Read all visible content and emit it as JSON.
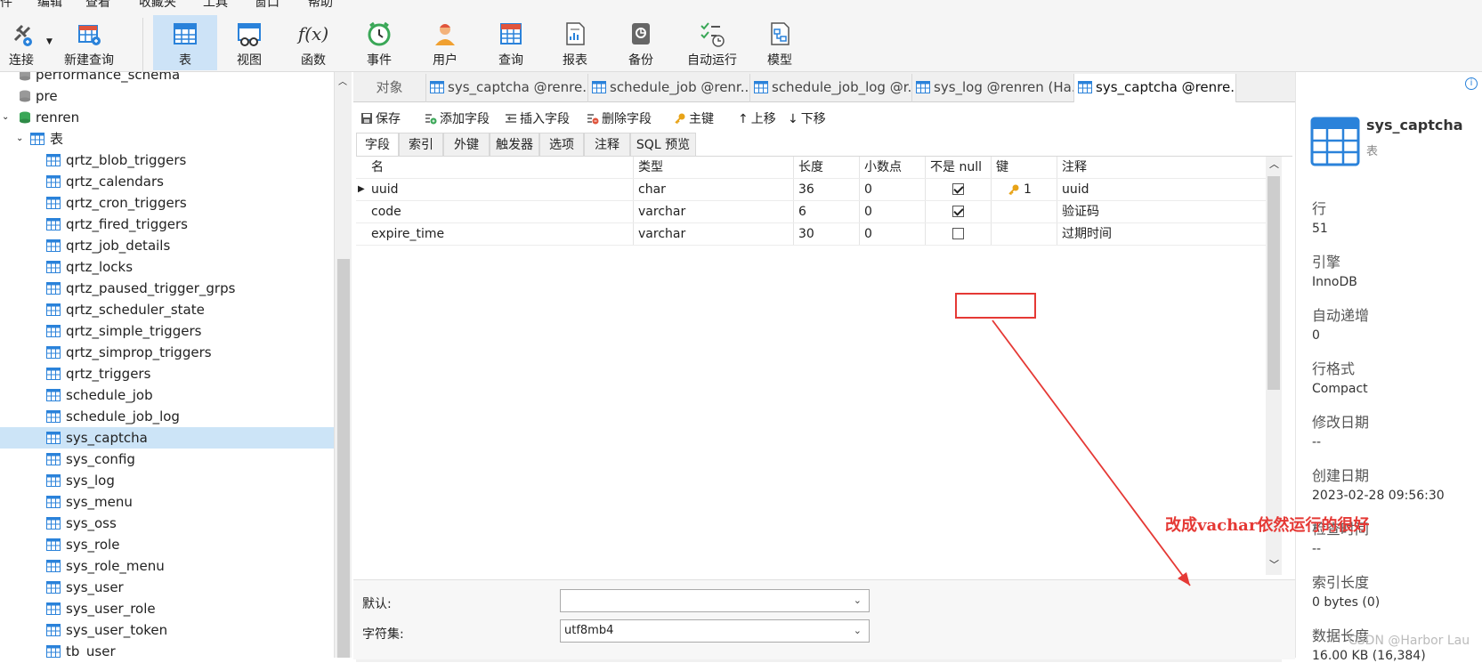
{
  "menu": [
    "件",
    "编辑",
    "查看",
    "收藏夹",
    "工具",
    "窗口",
    "帮助"
  ],
  "toolbar": {
    "connect": "连接",
    "new_query": "新建查询",
    "table": "表",
    "view": "视图",
    "function": "函数",
    "event": "事件",
    "user": "用户",
    "query": "查询",
    "report": "报表",
    "backup": "备份",
    "autorun": "自动运行",
    "model": "模型",
    "function_glyph": "f(x)"
  },
  "tree": {
    "db_perf": "performance_schema",
    "db_pre": "pre",
    "db_renren": "renren",
    "tables_node": "表",
    "tables": [
      "qrtz_blob_triggers",
      "qrtz_calendars",
      "qrtz_cron_triggers",
      "qrtz_fired_triggers",
      "qrtz_job_details",
      "qrtz_locks",
      "qrtz_paused_trigger_grps",
      "qrtz_scheduler_state",
      "qrtz_simple_triggers",
      "qrtz_simprop_triggers",
      "qrtz_triggers",
      "schedule_job",
      "schedule_job_log",
      "sys_captcha",
      "sys_config",
      "sys_log",
      "sys_menu",
      "sys_oss",
      "sys_role",
      "sys_role_menu",
      "sys_user",
      "sys_user_role",
      "sys_user_token",
      "tb_user"
    ],
    "selected_index": 13
  },
  "tabs": [
    "对象",
    "sys_captcha @renre...",
    "schedule_job @renr...",
    "schedule_job_log @r...",
    "sys_log @renren (Ha...",
    "sys_captcha @renre..."
  ],
  "actions": {
    "save": "保存",
    "add_field": "添加字段",
    "insert_field": "插入字段",
    "delete_field": "删除字段",
    "primary_key": "主键",
    "move_up": "上移",
    "move_down": "下移"
  },
  "subtabs": [
    "字段",
    "索引",
    "外键",
    "触发器",
    "选项",
    "注释",
    "SQL 预览"
  ],
  "columns": [
    "名",
    "类型",
    "长度",
    "小数点",
    "不是 null",
    "键",
    "注释"
  ],
  "rows": [
    {
      "name": "uuid",
      "type": "char",
      "length": "36",
      "decimals": "0",
      "not_null": true,
      "key": "1",
      "comment": "uuid"
    },
    {
      "name": "code",
      "type": "varchar",
      "length": "6",
      "decimals": "0",
      "not_null": true,
      "key": "",
      "comment": "验证码"
    },
    {
      "name": "expire_time",
      "type": "varchar",
      "length": "30",
      "decimals": "0",
      "not_null": false,
      "key": "",
      "comment": "过期时间"
    }
  ],
  "bottom": {
    "default_label": "默认:",
    "charset_label": "字符集:",
    "charset_value": "utf8mb4"
  },
  "info": {
    "table_name": "sys_captcha",
    "table_kind": "表",
    "rows_label": "行",
    "rows_value": "51",
    "engine_label": "引擎",
    "engine_value": "InnoDB",
    "autoinc_label": "自动递增",
    "autoinc_value": "0",
    "rowformat_label": "行格式",
    "rowformat_value": "Compact",
    "modified_label": "修改日期",
    "modified_value": "--",
    "created_label": "创建日期",
    "created_value": "2023-02-28 09:56:30",
    "checked_label": "检查时间",
    "checked_value": "--",
    "index_len_label": "索引长度",
    "index_len_value": "0 bytes (0)",
    "data_len_label": "数据长度",
    "data_len_value": "16.00 KB (16,384)"
  },
  "annotation": "改成vachar依然运行的很好",
  "watermark": "CSDN @Harbor Lau",
  "colors": {
    "accent": "#2a82da",
    "selected": "#cce4f7",
    "annotation": "#e53935",
    "table_icon": "#2a82da"
  }
}
